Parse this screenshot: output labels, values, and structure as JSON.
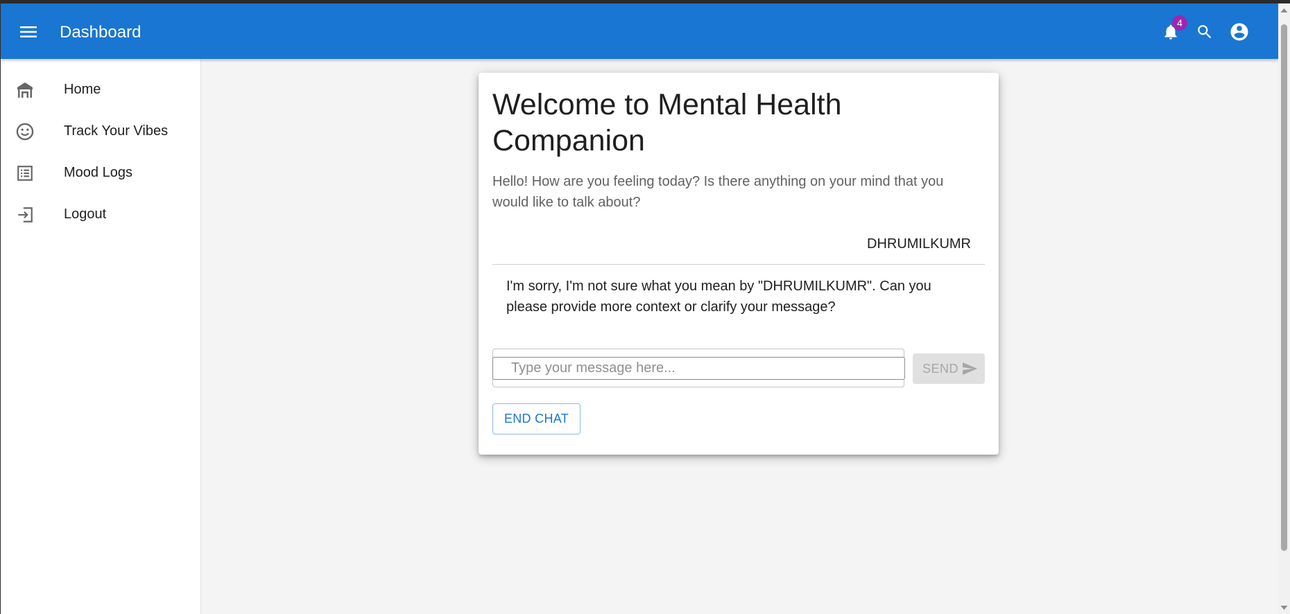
{
  "appbar": {
    "title": "Dashboard",
    "notification_count": "4",
    "icons": [
      "menu-icon",
      "bell-icon",
      "search-icon",
      "account-circle-icon"
    ],
    "color": "#1976d2"
  },
  "sidebar": {
    "items": [
      {
        "label": "Home",
        "icon": "home-icon"
      },
      {
        "label": "Track Your Vibes",
        "icon": "smiley-icon"
      },
      {
        "label": "Mood Logs",
        "icon": "list-icon"
      },
      {
        "label": "Logout",
        "icon": "logout-icon"
      }
    ]
  },
  "chat": {
    "title": "Welcome to Mental Health Companion",
    "intro": "Hello! How are you feeling today? Is there anything on your mind that you would like to talk about?",
    "user_message": "DHRUMILKUMR",
    "bot_message": "I'm sorry, I'm not sure what you mean by \"DHRUMILKUMR\". Can you please provide more context or clarify your message?",
    "input_placeholder": "Type your message here...",
    "input_value": "",
    "send_label": "SEND",
    "end_chat_label": "END CHAT"
  },
  "colors": {
    "accent": "#1976d2",
    "badge": "#9c27b0",
    "background": "#f4f4f4"
  }
}
